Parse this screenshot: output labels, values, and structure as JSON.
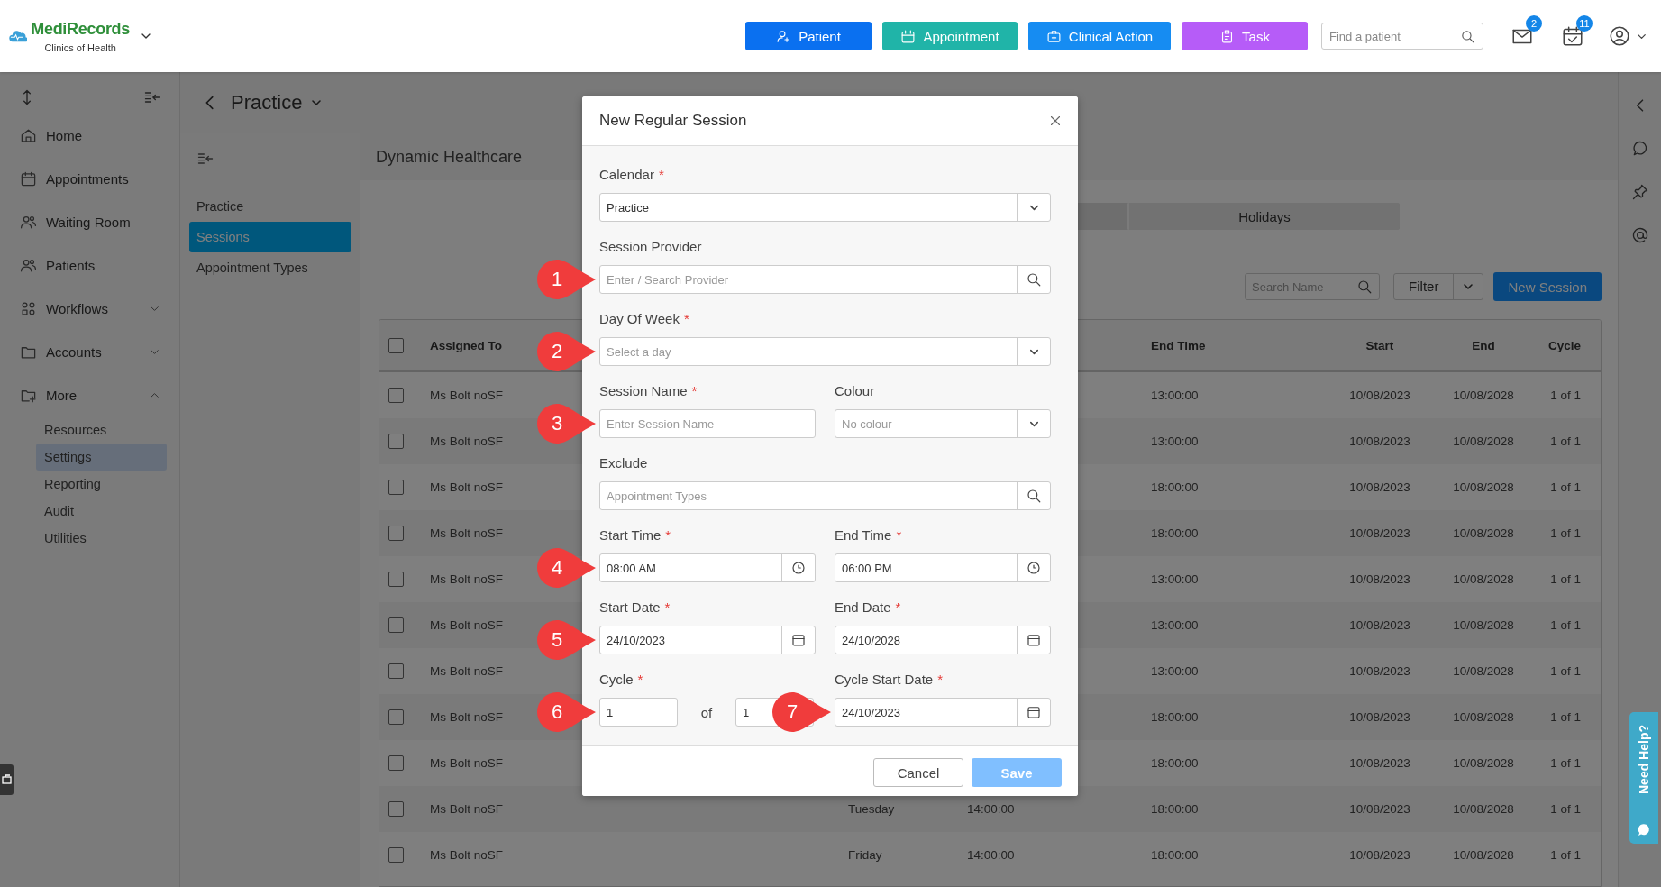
{
  "header": {
    "logo": {
      "name": "MediRecords",
      "subtitle": "Clinics of Health"
    },
    "actions": [
      {
        "label": "Patient"
      },
      {
        "label": "Appointment"
      },
      {
        "label": "Clinical Action"
      },
      {
        "label": "Task"
      }
    ],
    "search": {
      "placeholder": "Find a patient"
    },
    "mail_badge": "2",
    "tasks_badge": "11"
  },
  "sidebar": {
    "items": [
      {
        "label": "Home"
      },
      {
        "label": "Appointments"
      },
      {
        "label": "Waiting Room"
      },
      {
        "label": "Patients"
      },
      {
        "label": "Workflows",
        "expanded": false
      },
      {
        "label": "Accounts",
        "expanded": false
      },
      {
        "label": "More",
        "expanded": true,
        "children": [
          {
            "label": "Resources",
            "selected": false
          },
          {
            "label": "Settings",
            "selected": true
          },
          {
            "label": "Reporting",
            "selected": false
          },
          {
            "label": "Audit",
            "selected": false
          },
          {
            "label": "Utilities",
            "selected": false
          }
        ]
      }
    ]
  },
  "page": {
    "title": "Practice"
  },
  "subnav": {
    "items": [
      {
        "label": "Practice",
        "selected": false
      },
      {
        "label": "Sessions",
        "selected": true
      },
      {
        "label": "Appointment Types",
        "selected": false
      }
    ]
  },
  "content": {
    "title": "Dynamic Healthcare",
    "tabs": [
      {
        "label": "Holidays",
        "selected": false
      }
    ],
    "search": {
      "placeholder": "Search Name"
    },
    "filter": "Filter",
    "new_session": "New Session"
  },
  "table": {
    "header_checked": false,
    "columns": [
      "Assigned To",
      "End Time",
      "Start",
      "End",
      "Cycle"
    ],
    "rows": [
      {
        "checked": false,
        "assigned_to": "Ms Bolt noSF",
        "end_time": "13:00:00",
        "start": "10/08/2023",
        "end": "10/08/2028",
        "cycle": "1 of 1"
      },
      {
        "checked": false,
        "assigned_to": "Ms Bolt noSF",
        "end_time": "13:00:00",
        "start": "10/08/2023",
        "end": "10/08/2028",
        "cycle": "1 of 1"
      },
      {
        "checked": false,
        "assigned_to": "Ms Bolt noSF",
        "end_time": "18:00:00",
        "start": "10/08/2023",
        "end": "10/08/2028",
        "cycle": "1 of 1"
      },
      {
        "checked": false,
        "assigned_to": "Ms Bolt noSF",
        "end_time": "18:00:00",
        "start": "10/08/2023",
        "end": "10/08/2028",
        "cycle": "1 of 1"
      },
      {
        "checked": false,
        "assigned_to": "Ms Bolt noSF",
        "end_time": "13:00:00",
        "start": "10/08/2023",
        "end": "10/08/2028",
        "cycle": "1 of 1"
      },
      {
        "checked": false,
        "assigned_to": "Ms Bolt noSF",
        "end_time": "13:00:00",
        "start": "10/08/2023",
        "end": "10/08/2028",
        "cycle": "1 of 1"
      },
      {
        "checked": false,
        "assigned_to": "Ms Bolt noSF",
        "end_time": "13:00:00",
        "start": "10/08/2023",
        "end": "10/08/2028",
        "cycle": "1 of 1"
      },
      {
        "checked": false,
        "assigned_to": "Ms Bolt noSF",
        "end_time": "18:00:00",
        "start": "10/08/2023",
        "end": "10/08/2028",
        "cycle": "1 of 1"
      },
      {
        "checked": false,
        "assigned_to": "Ms Bolt noSF",
        "end_time": "18:00:00",
        "start": "10/08/2023",
        "end": "10/08/2028",
        "cycle": "1 of 1"
      },
      {
        "checked": false,
        "assigned_to": "Ms Bolt noSF",
        "column_3": "Tuesday",
        "column_4": "14:00:00",
        "end_time": "18:00:00",
        "start": "10/08/2023",
        "end": "10/08/2028",
        "cycle": "1 of 1"
      },
      {
        "checked": false,
        "assigned_to": "Ms Bolt noSF",
        "column_3": "Friday",
        "column_4": "14:00:00",
        "end_time": "18:00:00",
        "start": "10/08/2023",
        "end": "10/08/2028",
        "cycle": "1 of 1"
      }
    ]
  },
  "dialog": {
    "title": "New Regular Session",
    "rows": [
      [
        {
          "kind": "select",
          "label": "Calendar",
          "required_mark": "*",
          "value": "Practice"
        }
      ],
      [
        {
          "kind": "search",
          "label": "Session Provider",
          "placeholder": "Enter / Search Provider",
          "callout": "1"
        }
      ],
      [
        {
          "kind": "select",
          "label": "Day Of Week",
          "required_mark": "*",
          "placeholder": "Select a day",
          "callout": "2"
        }
      ],
      [
        {
          "kind": "text",
          "label": "Session Name",
          "required_mark": "*",
          "placeholder": "Enter Session Name",
          "callout": "3"
        },
        {
          "kind": "select",
          "label": "Colour",
          "placeholder": "No colour"
        }
      ],
      [
        {
          "kind": "search",
          "label": "Exclude",
          "placeholder": "Appointment Types"
        }
      ],
      [
        {
          "kind": "time",
          "label": "Start Time",
          "required_mark": "*",
          "value": "08:00 AM",
          "callout": "4"
        },
        {
          "kind": "time",
          "label": "End Time",
          "required_mark": "*",
          "value": "06:00 PM"
        }
      ],
      [
        {
          "kind": "date",
          "label": "Start Date",
          "required_mark": "*",
          "value": "24/10/2023",
          "callout": "5"
        },
        {
          "kind": "date",
          "label": "End Date",
          "required_mark": "*",
          "value": "24/10/2028"
        }
      ],
      [
        {
          "kind": "cycle",
          "label": "Cycle",
          "required_mark": "*",
          "value": "1",
          "of": "of",
          "total": "1",
          "callout": "6"
        },
        {
          "kind": "date",
          "label": "Cycle Start Date",
          "required_mark": "*",
          "value": "24/10/2023",
          "callout": "7"
        }
      ]
    ],
    "buttons": [
      {
        "label": "Cancel",
        "kind": "secondary",
        "disabled": false
      },
      {
        "label": "Save",
        "kind": "primary",
        "disabled": true
      }
    ]
  },
  "help": {
    "label": "Need Help?"
  }
}
